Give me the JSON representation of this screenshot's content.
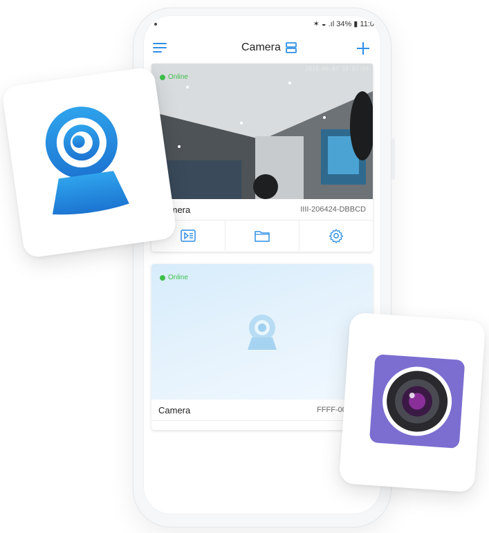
{
  "status_bar": {
    "text": "✶ ◒ .ıl 34% ▮ 11:0"
  },
  "header": {
    "title": "Camera"
  },
  "cameras": [
    {
      "name": "Camera",
      "id": "IIII-206424-DBBCD",
      "status": "Online",
      "timestamp": "2018-06-07 18:57:59"
    },
    {
      "name": "Camera",
      "id": "FFFF-000718-",
      "status": "Online"
    }
  ],
  "colors": {
    "accent": "#2d8ee6",
    "online": "#3fbf4a",
    "tile_purple": "#7b6ed0"
  },
  "icons": {
    "menu": "menu-icon",
    "layout": "layout-icon",
    "add": "plus-icon",
    "playback": "playback-icon",
    "folder": "folder-icon",
    "settings": "gear-icon"
  }
}
